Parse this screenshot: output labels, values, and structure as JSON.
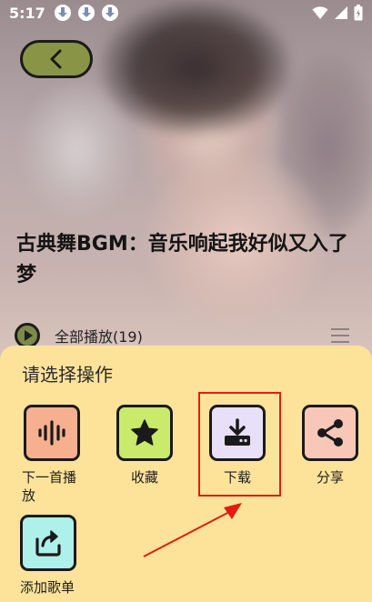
{
  "status_bar": {
    "time": "5:17"
  },
  "header": {
    "title": "古典舞BGM：音乐响起我好似又入了梦"
  },
  "play_all": {
    "label": "全部播放(19)"
  },
  "sheet": {
    "heading": "请选择操作",
    "options": [
      {
        "label": "下一首播放",
        "icon": "waveform-icon",
        "color": "#f6b08f"
      },
      {
        "label": "收藏",
        "icon": "star-icon",
        "color": "#c9ea6a"
      },
      {
        "label": "下载",
        "icon": "download-icon",
        "color": "#e7e0f8"
      },
      {
        "label": "分享",
        "icon": "share-icon",
        "color": "#f8c7b8"
      },
      {
        "label": "添加歌单",
        "icon": "add-to-playlist-icon",
        "color": "#aef1ea"
      }
    ]
  },
  "colors": {
    "sheet_bg": "#fde39a",
    "highlight": "#e41b12",
    "back_button": "#8a9446"
  }
}
